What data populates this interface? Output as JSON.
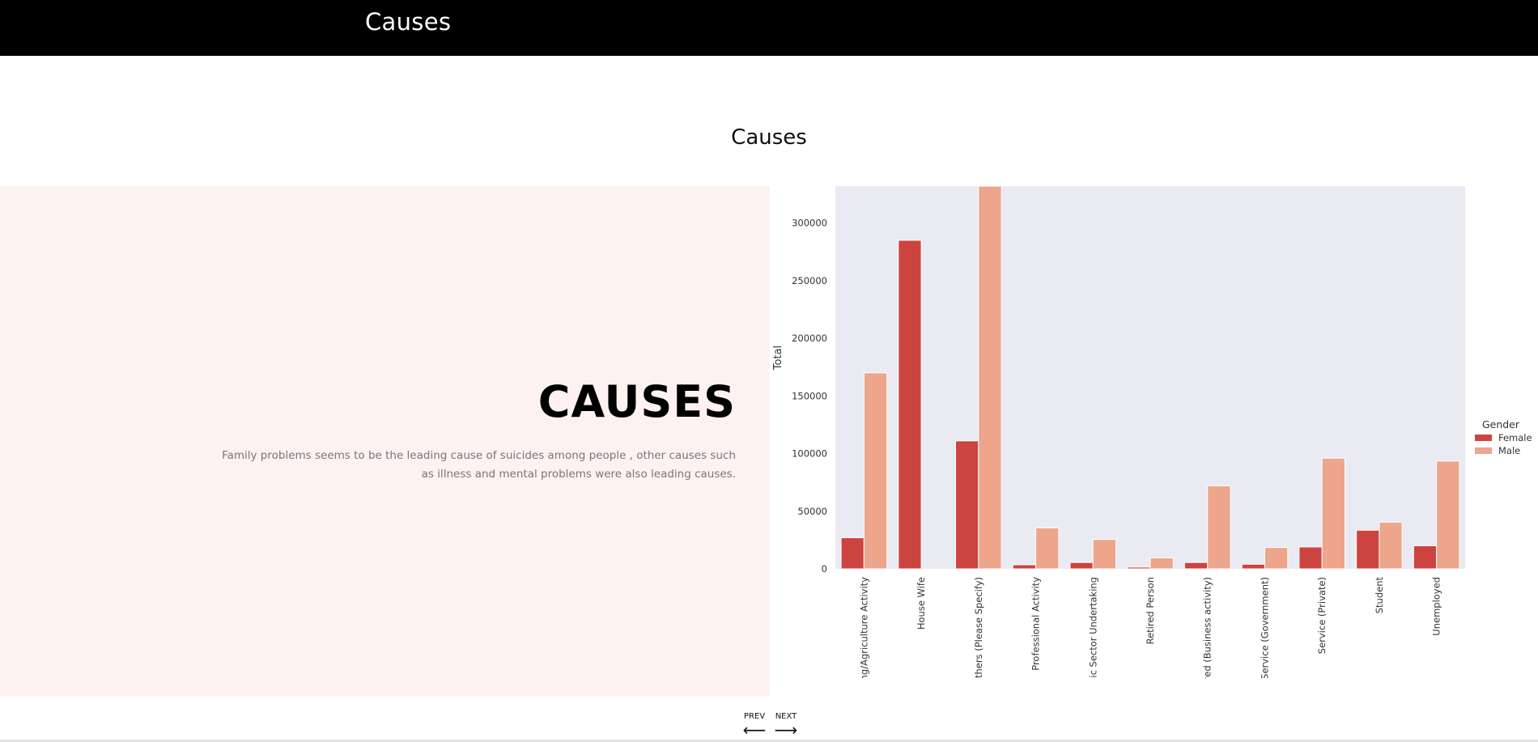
{
  "header": {
    "title": "Causes"
  },
  "section": {
    "title": "Causes"
  },
  "panel": {
    "heading": "CAUSES",
    "description": "Family problems seems to be the leading cause of suicides among people , other causes such as illness and mental problems were also leading causes."
  },
  "nav": {
    "prev_label": "PREV",
    "next_label": "NEXT",
    "prev_icon": "arrow-left-icon",
    "next_icon": "arrow-right-icon"
  },
  "colors": {
    "female": "#cc4440",
    "male": "#eda58c",
    "plot_bg": "#eaeaf2",
    "panel_bg": "#fdf2f0"
  },
  "chart_data": {
    "type": "bar",
    "ylabel": "Total",
    "xlabel": "",
    "ylim": [
      0,
      332000
    ],
    "yticks": [
      0,
      50000,
      100000,
      150000,
      200000,
      250000,
      300000
    ],
    "grid": false,
    "legend": {
      "title": "Gender",
      "placement": "right"
    },
    "categories": [
      "rming/Agriculture Activity",
      "House Wife",
      "Others (Please Specify)",
      "Professional Activity",
      "ublic Sector Undertaking",
      "Retired Person",
      "loyed (Business activity)",
      "Service (Government)",
      "Service (Private)",
      "Student",
      "Unemployed"
    ],
    "series": [
      {
        "name": "Female",
        "values": [
          27000,
          285000,
          111000,
          3500,
          5500,
          1500,
          5500,
          4000,
          19000,
          33500,
          20000
        ]
      },
      {
        "name": "Male",
        "values": [
          170000,
          0,
          332000,
          35500,
          25500,
          9500,
          72000,
          18500,
          96000,
          40500,
          93500
        ]
      }
    ]
  }
}
